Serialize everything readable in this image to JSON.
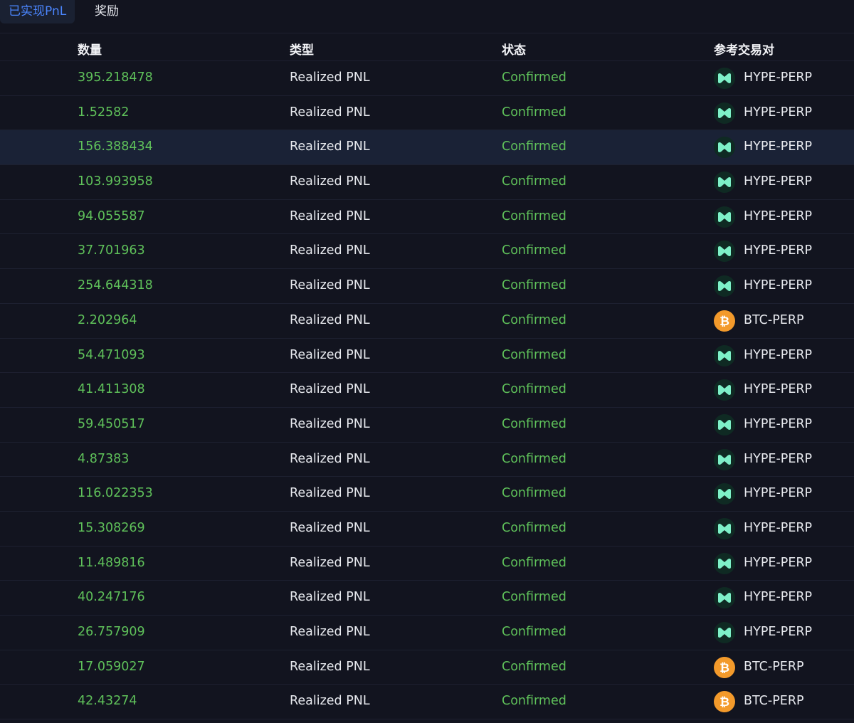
{
  "tabs": [
    {
      "label": "已实现PnL",
      "active": true
    },
    {
      "label": "奖励",
      "active": false
    }
  ],
  "columns": {
    "amount": "数量",
    "type": "类型",
    "status": "状态",
    "pair": "参考交易对"
  },
  "colors": {
    "positive": "#5fc15a",
    "accent": "#4b86ff",
    "hype_icon": "#7ef0c8",
    "btc_icon": "#f39a2b"
  },
  "rows": [
    {
      "amount": "395.218478",
      "type": "Realized PNL",
      "status": "Confirmed",
      "pair": "HYPE-PERP",
      "icon": "hype-icon"
    },
    {
      "amount": "1.52582",
      "type": "Realized PNL",
      "status": "Confirmed",
      "pair": "HYPE-PERP",
      "icon": "hype-icon"
    },
    {
      "amount": "156.388434",
      "type": "Realized PNL",
      "status": "Confirmed",
      "pair": "HYPE-PERP",
      "icon": "hype-icon",
      "highlight": true
    },
    {
      "amount": "103.993958",
      "type": "Realized PNL",
      "status": "Confirmed",
      "pair": "HYPE-PERP",
      "icon": "hype-icon"
    },
    {
      "amount": "94.055587",
      "type": "Realized PNL",
      "status": "Confirmed",
      "pair": "HYPE-PERP",
      "icon": "hype-icon"
    },
    {
      "amount": "37.701963",
      "type": "Realized PNL",
      "status": "Confirmed",
      "pair": "HYPE-PERP",
      "icon": "hype-icon"
    },
    {
      "amount": "254.644318",
      "type": "Realized PNL",
      "status": "Confirmed",
      "pair": "HYPE-PERP",
      "icon": "hype-icon"
    },
    {
      "amount": "2.202964",
      "type": "Realized PNL",
      "status": "Confirmed",
      "pair": "BTC-PERP",
      "icon": "btc-icon"
    },
    {
      "amount": "54.471093",
      "type": "Realized PNL",
      "status": "Confirmed",
      "pair": "HYPE-PERP",
      "icon": "hype-icon"
    },
    {
      "amount": "41.411308",
      "type": "Realized PNL",
      "status": "Confirmed",
      "pair": "HYPE-PERP",
      "icon": "hype-icon"
    },
    {
      "amount": "59.450517",
      "type": "Realized PNL",
      "status": "Confirmed",
      "pair": "HYPE-PERP",
      "icon": "hype-icon"
    },
    {
      "amount": "4.87383",
      "type": "Realized PNL",
      "status": "Confirmed",
      "pair": "HYPE-PERP",
      "icon": "hype-icon"
    },
    {
      "amount": "116.022353",
      "type": "Realized PNL",
      "status": "Confirmed",
      "pair": "HYPE-PERP",
      "icon": "hype-icon"
    },
    {
      "amount": "15.308269",
      "type": "Realized PNL",
      "status": "Confirmed",
      "pair": "HYPE-PERP",
      "icon": "hype-icon"
    },
    {
      "amount": "11.489816",
      "type": "Realized PNL",
      "status": "Confirmed",
      "pair": "HYPE-PERP",
      "icon": "hype-icon"
    },
    {
      "amount": "40.247176",
      "type": "Realized PNL",
      "status": "Confirmed",
      "pair": "HYPE-PERP",
      "icon": "hype-icon"
    },
    {
      "amount": "26.757909",
      "type": "Realized PNL",
      "status": "Confirmed",
      "pair": "HYPE-PERP",
      "icon": "hype-icon"
    },
    {
      "amount": "17.059027",
      "type": "Realized PNL",
      "status": "Confirmed",
      "pair": "BTC-PERP",
      "icon": "btc-icon"
    },
    {
      "amount": "42.43274",
      "type": "Realized PNL",
      "status": "Confirmed",
      "pair": "BTC-PERP",
      "icon": "btc-icon"
    }
  ]
}
